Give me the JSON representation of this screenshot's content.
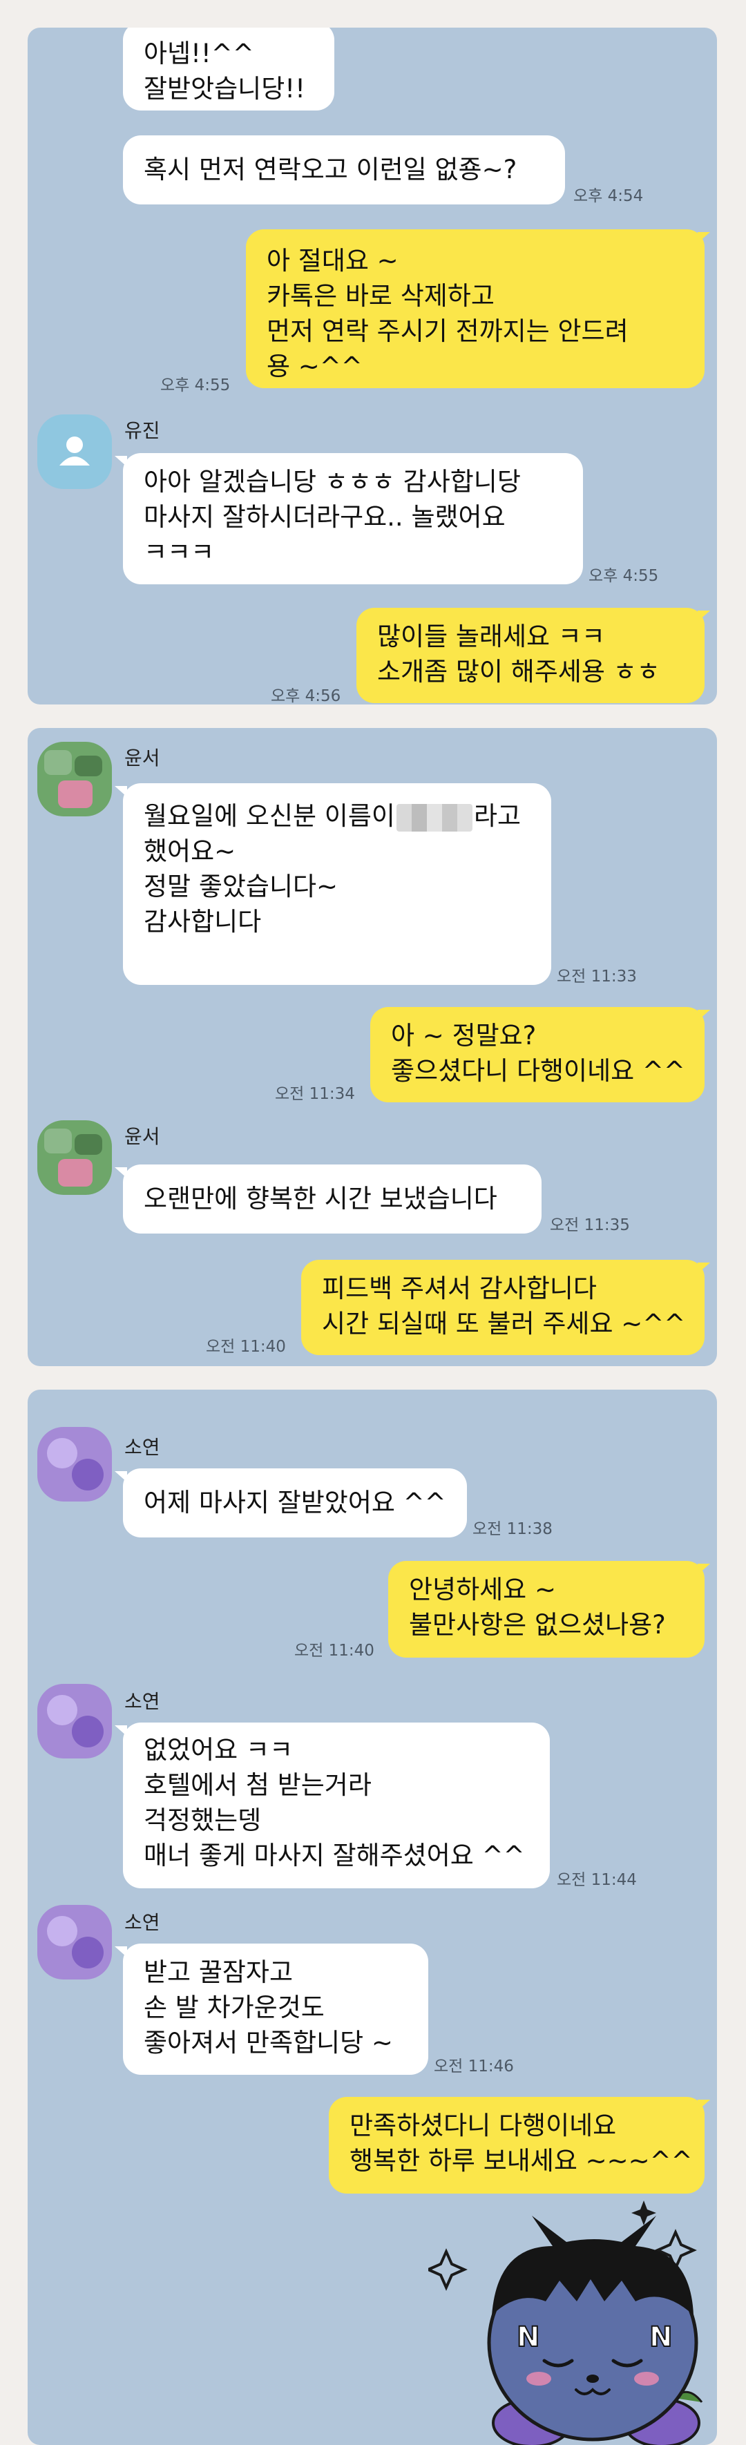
{
  "panel1": {
    "messages": [
      {
        "lines": [
          "아넵!!^^",
          "잘받앗습니당!!"
        ],
        "time": ""
      },
      {
        "lines": [
          "혹시 먼저 연락오고 이런일 없죵~?"
        ],
        "time": "오후 4:54"
      },
      {
        "lines": [
          "아 절대요 ~",
          "카톡은 바로 삭제하고",
          "먼저 연락 주시기 전까지는 안드려",
          "용 ~^^"
        ],
        "time": "오후 4:55"
      },
      {
        "sender": "유진",
        "lines": [
          "아아 알겠습니당 ㅎㅎㅎ 감사합니당",
          "마사지 잘하시더라구요.. 놀랬어요",
          "ㅋㅋㅋ"
        ],
        "time": "오후 4:55"
      },
      {
        "lines": [
          "많이들 놀래세요 ㅋㅋ",
          "소개좀 많이 해주세용 ㅎㅎ"
        ],
        "time": "오후 4:56"
      }
    ]
  },
  "panel2": {
    "messages": [
      {
        "sender": "윤서",
        "line1_pre": "월요일에 오신분 이름이",
        "line1_post": "라고",
        "lines": [
          "했어요~",
          "정말 좋았습니다~",
          "감사합니다"
        ],
        "time": "오전 11:33"
      },
      {
        "lines": [
          "아 ~ 정말요?",
          "좋으셨다니 다행이네요 ^^"
        ],
        "time": "오전 11:34"
      },
      {
        "sender": "윤서",
        "lines": [
          "오랜만에 향복한 시간 보냈습니다"
        ],
        "time": "오전 11:35"
      },
      {
        "lines": [
          "피드백 주셔서 감사합니다",
          "시간 되실때 또 불러 주세요 ~^^"
        ],
        "time": "오전 11:40"
      }
    ]
  },
  "panel3": {
    "messages": [
      {
        "sender": "소연",
        "lines": [
          "어제 마사지 잘받았어요 ^^"
        ],
        "time": "오전 11:38"
      },
      {
        "lines": [
          "안녕하세요 ~",
          "불만사항은 없으셨나용?"
        ],
        "time": "오전 11:40"
      },
      {
        "sender": "소연",
        "lines": [
          "없었어요 ㅋㅋ",
          "호텔에서 첨 받는거라",
          "걱정했는뎅",
          "매너 좋게 마사지 잘해주셨어요 ^^"
        ],
        "time": "오전 11:44"
      },
      {
        "sender": "소연",
        "lines": [
          "받고 꿀잠자고",
          "손 발 차가운것도",
          "좋아져서 만족합니당 ~"
        ],
        "time": "오전 11:46"
      },
      {
        "lines": [
          "만족하셨다니 다행이네요",
          "행복한 하루 보내세요 ~~~^^"
        ],
        "time": ""
      }
    ],
    "sticker": "cartoon-character-sticker"
  },
  "colors": {
    "chat_bg": "#b2c6da",
    "incoming": "#ffffff",
    "outgoing": "#fbe64a",
    "page_bg": "#f2efec"
  }
}
